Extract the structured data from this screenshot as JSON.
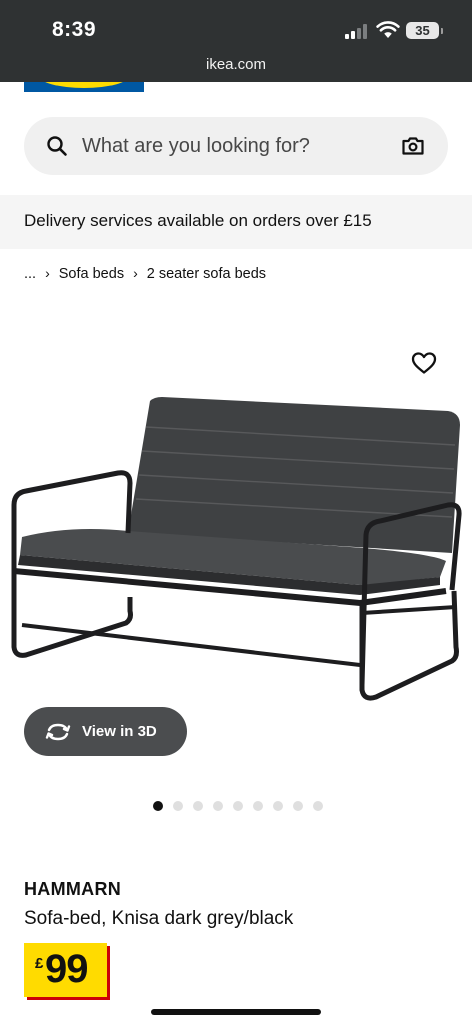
{
  "status_bar": {
    "time": "8:39",
    "url": "ikea.com",
    "battery": "35"
  },
  "search": {
    "placeholder": "What are you looking for?"
  },
  "delivery_banner": "Delivery services available on orders over £15",
  "breadcrumb": {
    "ellipsis": "...",
    "items": [
      "Sofa beds",
      "2 seater sofa beds"
    ]
  },
  "view_3d": {
    "label": "View in 3D"
  },
  "carousel": {
    "count": 9,
    "active": 1
  },
  "product": {
    "name": "HAMMARN",
    "description": "Sofa-bed, Knisa dark grey/black",
    "price_currency": "£",
    "price_value": "99"
  },
  "colors": {
    "brand_blue": "#0058a3",
    "brand_yellow": "#ffdb00",
    "price_accent": "#cc0008"
  },
  "icons": [
    "search-icon",
    "camera-icon",
    "heart-icon",
    "rotate-3d-icon",
    "chevron-right-icon"
  ]
}
